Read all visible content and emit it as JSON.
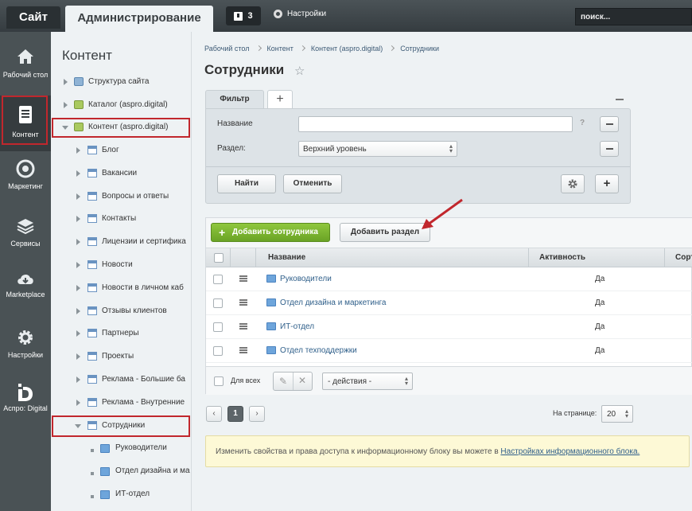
{
  "topbar": {
    "site_tab": "Сайт",
    "admin_tab": "Администрирование",
    "notif_count": "3",
    "settings_label": "Настройки",
    "search_placeholder": "поиск..."
  },
  "leftnav": [
    {
      "label": "Рабочий стол",
      "icon": "home-icon"
    },
    {
      "label": "Контент",
      "icon": "document-icon",
      "active": true
    },
    {
      "label": "Маркетинг",
      "icon": "target-icon"
    },
    {
      "label": "Сервисы",
      "icon": "layers-icon"
    },
    {
      "label": "Marketplace",
      "icon": "cloud-download-icon"
    },
    {
      "label": "Настройки",
      "icon": "gear-icon"
    },
    {
      "label": "Аспро: Digital",
      "icon": "aspro-logo-icon"
    }
  ],
  "tree": {
    "title": "Контент",
    "items": [
      {
        "label": "Структура сайта"
      },
      {
        "label": "Каталог (aspro.digital)"
      },
      {
        "label": "Контент (aspro.digital)"
      },
      {
        "label": "Блог"
      },
      {
        "label": "Вакансии"
      },
      {
        "label": "Вопросы и ответы"
      },
      {
        "label": "Контакты"
      },
      {
        "label": "Лицензии и сертифика"
      },
      {
        "label": "Новости"
      },
      {
        "label": "Новости в личном каб"
      },
      {
        "label": "Отзывы клиентов"
      },
      {
        "label": "Партнеры"
      },
      {
        "label": "Проекты"
      },
      {
        "label": "Реклама - Большие ба"
      },
      {
        "label": "Реклама - Внутренние"
      },
      {
        "label": "Сотрудники"
      },
      {
        "label": "Руководители"
      },
      {
        "label": "Отдел дизайна и ма"
      },
      {
        "label": "ИТ-отдел"
      }
    ]
  },
  "breadcrumbs": [
    "Рабочий стол",
    "Контент",
    "Контент (aspro.digital)",
    "Сотрудники"
  ],
  "page_title": "Сотрудники",
  "filter": {
    "tab_label": "Фильтр",
    "add_tab": "+",
    "name_label": "Название",
    "name_value": "",
    "help": "?",
    "section_label": "Раздел:",
    "section_value": "Верхний уровень",
    "find_button": "Найти",
    "cancel_button": "Отменить",
    "add_button": "+"
  },
  "toolbar": {
    "add_employee": "Добавить сотрудника",
    "add_section": "Добавить раздел"
  },
  "table": {
    "columns": [
      "Название",
      "Активность",
      "Сорт"
    ],
    "rows": [
      {
        "name": "Руководители",
        "active": "Да"
      },
      {
        "name": "Отдел дизайна и маркетинга",
        "active": "Да"
      },
      {
        "name": "ИТ-отдел",
        "active": "Да"
      },
      {
        "name": "Отдел техподдержки",
        "active": "Да"
      }
    ],
    "for_all": "Для всех",
    "actions": "- действия -"
  },
  "pagination": {
    "prev": "‹",
    "current": "1",
    "next": "›",
    "per_page_label": "На странице:",
    "per_page": "20"
  },
  "note": {
    "text": "Изменить свойства и права доступа к информационному блоку вы можете в",
    "link": "Настройках информационного блока."
  },
  "colors": {
    "accent_red": "#c1272d",
    "green": "#7bb534",
    "link": "#2f5f8a"
  }
}
